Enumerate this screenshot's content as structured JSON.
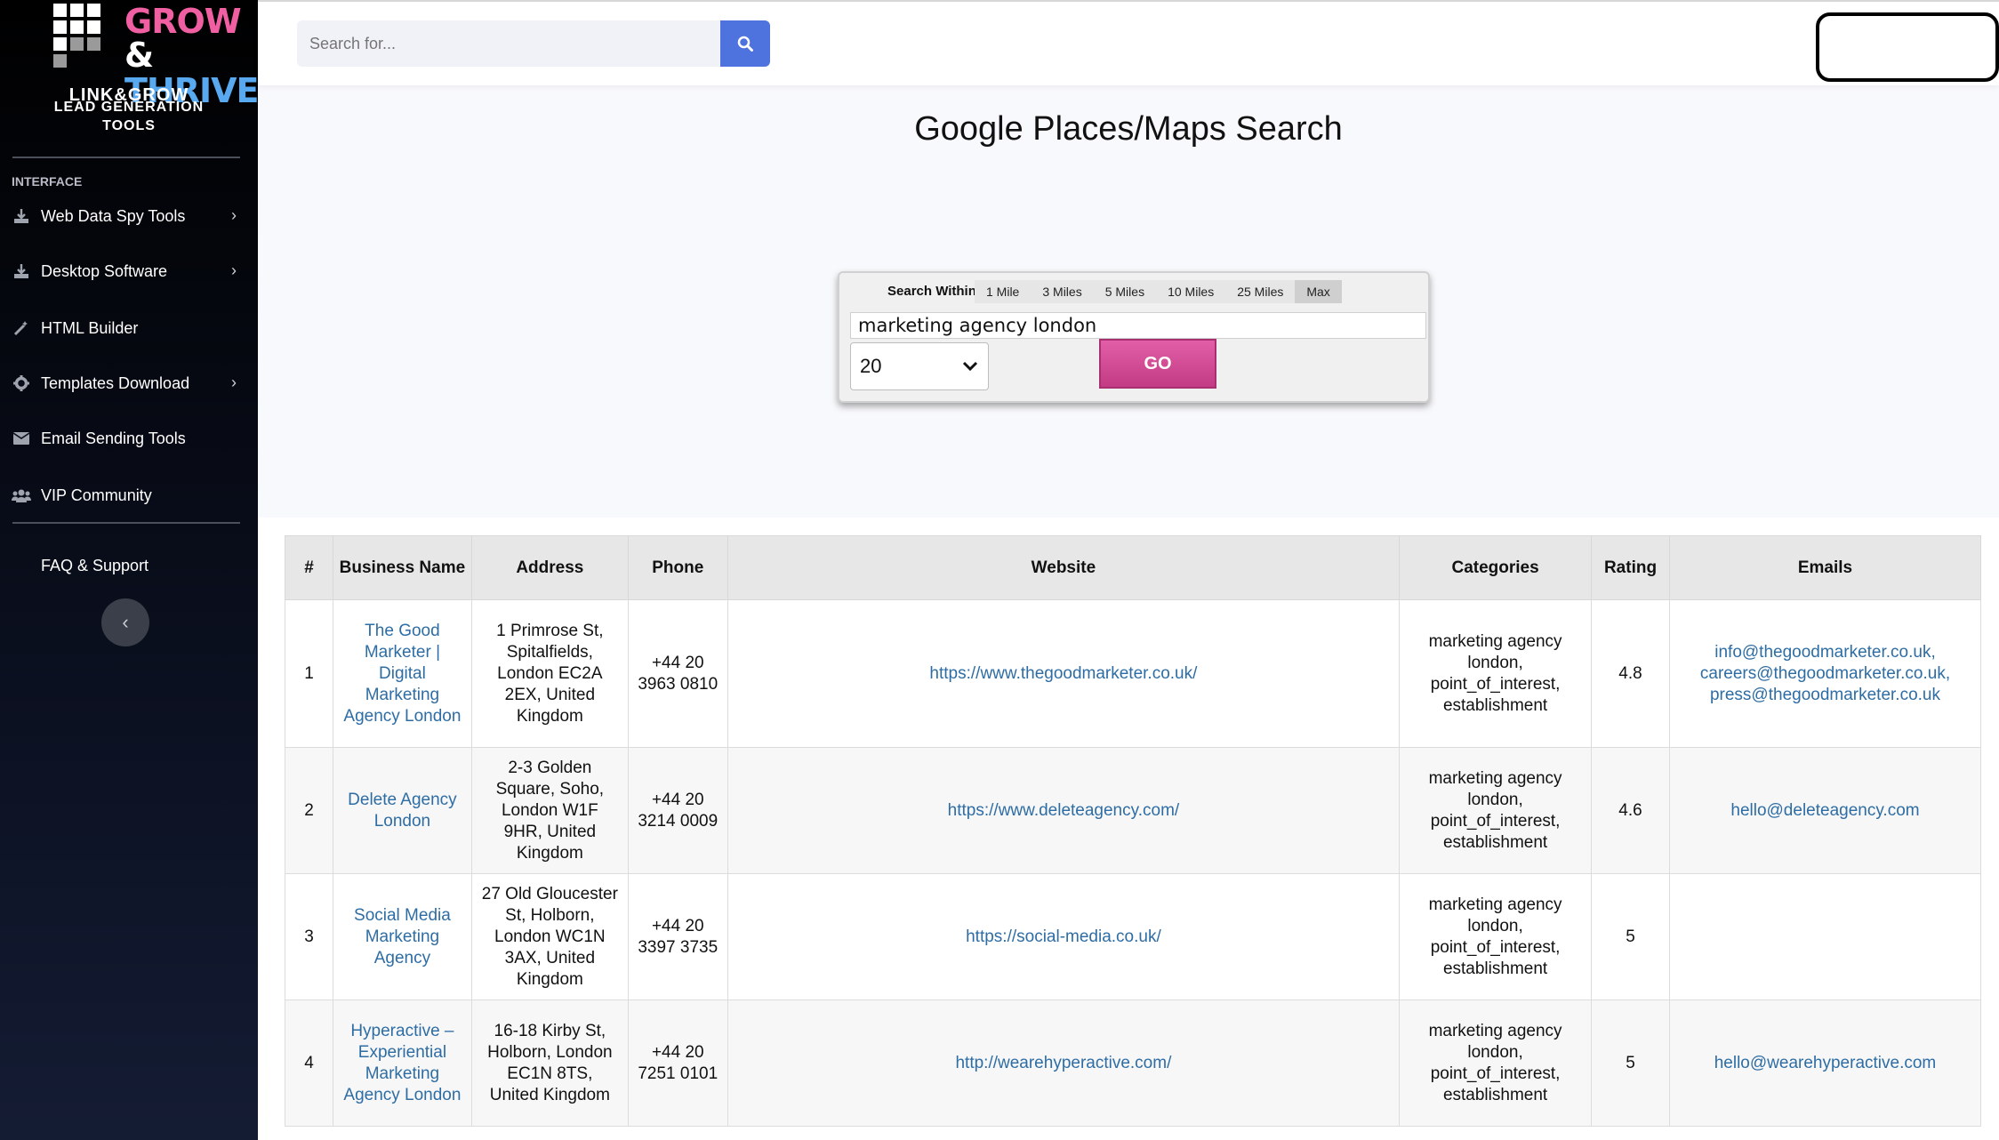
{
  "sidebar": {
    "brand_word1": "GROW",
    "brand_amp": "&",
    "brand_word2": "THRIVE",
    "brand_line1": "LINK&GROW",
    "brand_line2": "LEAD GENERATION",
    "brand_line3": "TOOLS",
    "section_heading": "INTERFACE",
    "items": [
      {
        "label": "Web Data Spy Tools",
        "icon": "download-icon",
        "has_submenu": true
      },
      {
        "label": "Desktop Software",
        "icon": "download-icon",
        "has_submenu": true
      },
      {
        "label": "HTML Builder",
        "icon": "wand-icon",
        "has_submenu": false
      },
      {
        "label": "Templates Download",
        "icon": "gear-icon",
        "has_submenu": true
      },
      {
        "label": "Email Sending Tools",
        "icon": "envelope-icon",
        "has_submenu": false
      },
      {
        "label": "VIP Community",
        "icon": "users-icon",
        "has_submenu": false
      }
    ],
    "faq_label": "FAQ & Support",
    "collapse_symbol": "‹"
  },
  "topbar": {
    "search_placeholder": "Search for..."
  },
  "page": {
    "title": "Google Places/Maps Search"
  },
  "search_widget": {
    "label": "Search Within",
    "radius_options": [
      "1 Mile",
      "3 Miles",
      "5 Miles",
      "10 Miles",
      "25 Miles",
      "Max"
    ],
    "selected_radius": "Max",
    "query": "marketing agency london",
    "result_count": "20",
    "go_label": "GO"
  },
  "results": {
    "headers": {
      "num": "#",
      "name": "Business Name",
      "address": "Address",
      "phone": "Phone",
      "website": "Website",
      "categories": "Categories",
      "rating": "Rating",
      "emails": "Emails"
    },
    "rows": [
      {
        "num": "1",
        "name": "The Good Marketer | Digital Marketing Agency London",
        "address": "1 Primrose St, Spitalfields, London EC2A 2EX, United Kingdom",
        "phone": "+44 20 3963 0810",
        "website": "https://www.thegoodmarketer.co.uk/",
        "categories": "marketing agency london, point_of_interest, establishment",
        "rating": "4.8",
        "emails": [
          "info@thegoodmarketer.co.uk,",
          "careers@thegoodmarketer.co.uk,",
          "press@thegoodmarketer.co.uk"
        ]
      },
      {
        "num": "2",
        "name": "Delete Agency London",
        "address": "2-3 Golden Square, Soho, London W1F 9HR, United Kingdom",
        "phone": "+44 20 3214 0009",
        "website": "https://www.deleteagency.com/",
        "categories": "marketing agency london, point_of_interest, establishment",
        "rating": "4.6",
        "emails": [
          "hello@deleteagency.com"
        ]
      },
      {
        "num": "3",
        "name": "Social Media Marketing Agency",
        "address": "27 Old Gloucester St, Holborn, London WC1N 3AX, United Kingdom",
        "phone": "+44 20 3397 3735",
        "website": "https://social-media.co.uk/",
        "categories": "marketing agency london, point_of_interest, establishment",
        "rating": "5",
        "emails": []
      },
      {
        "num": "4",
        "name": "Hyperactive – Experiential Marketing Agency London",
        "address": "16-18 Kirby St, Holborn, London EC1N 8TS, United Kingdom",
        "phone": "+44 20 7251 0101",
        "website": "http://wearehyperactive.com/",
        "categories": "marketing agency london, point_of_interest, establishment",
        "rating": "5",
        "emails": [
          "hello@wearehyperactive.com"
        ]
      }
    ]
  },
  "colors": {
    "accent_blue": "#4e73df",
    "go_button_pink": "#d14b95",
    "link_blue": "#2e6da4",
    "sidebar_dark": "#0b1020"
  }
}
